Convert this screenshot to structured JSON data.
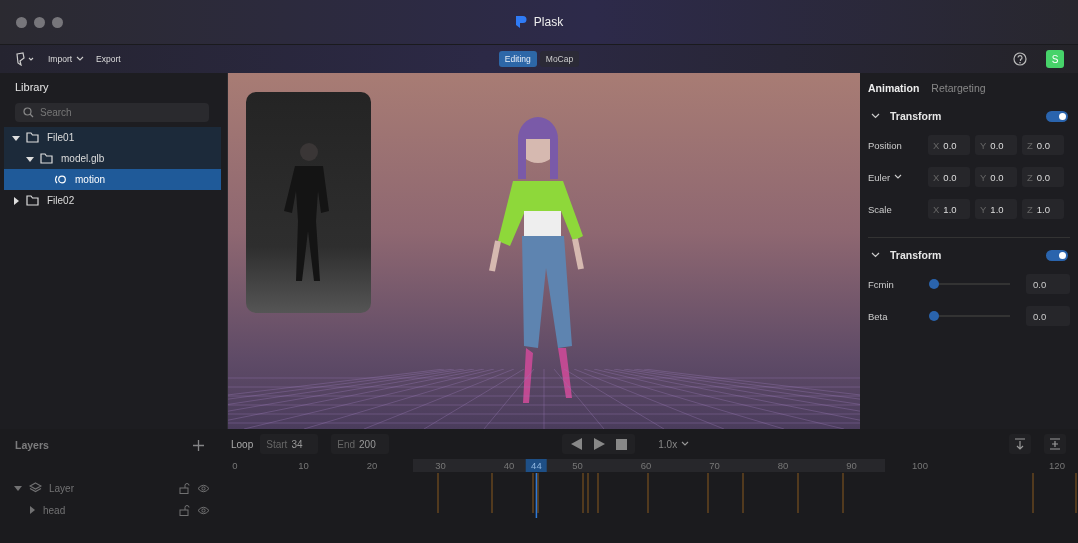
{
  "window": {
    "title": "Plask"
  },
  "toolbar": {
    "menus": [
      {
        "label": "Import",
        "dropdown": true
      },
      {
        "label": "Export",
        "dropdown": false
      }
    ],
    "modes": [
      {
        "label": "Editing",
        "selected": true
      },
      {
        "label": "MoCap",
        "selected": false
      }
    ],
    "avatar": "S"
  },
  "library": {
    "title": "Library",
    "search": {
      "placeholder": "Search"
    },
    "tree": [
      {
        "label": "File01",
        "kind": "folder",
        "expanded": true,
        "selected": false,
        "children": [
          {
            "label": "model.glb",
            "kind": "folder",
            "expanded": true,
            "selected": false,
            "children": [
              {
                "label": "motion",
                "kind": "motion",
                "selected": true
              }
            ]
          }
        ]
      },
      {
        "label": "File02",
        "kind": "folder",
        "expanded": false,
        "selected": false
      }
    ]
  },
  "inspector": {
    "tabs": [
      {
        "label": "Animation",
        "selected": true
      },
      {
        "label": "Retargeting",
        "selected": false
      }
    ],
    "sections": [
      {
        "title": "Transform",
        "on": true,
        "rows": [
          {
            "kind": "vector",
            "label": "Position",
            "dropdown": false,
            "values": [
              {
                "axis": "X",
                "value": "0.0"
              },
              {
                "axis": "Y",
                "value": "0.0"
              },
              {
                "axis": "Z",
                "value": "0.0"
              }
            ]
          },
          {
            "kind": "vector",
            "label": "Euler",
            "dropdown": true,
            "values": [
              {
                "axis": "X",
                "value": "0.0"
              },
              {
                "axis": "Y",
                "value": "0.0"
              },
              {
                "axis": "Z",
                "value": "0.0"
              }
            ]
          },
          {
            "kind": "vector",
            "label": "Scale",
            "dropdown": false,
            "values": [
              {
                "axis": "X",
                "value": "1.0"
              },
              {
                "axis": "Y",
                "value": "1.0"
              },
              {
                "axis": "Z",
                "value": "1.0"
              }
            ]
          }
        ]
      },
      {
        "title": "Transform",
        "on": true,
        "rows": [
          {
            "kind": "slider",
            "label": "Fcmin",
            "level": 0,
            "value": "0.0"
          },
          {
            "kind": "slider",
            "label": "Beta",
            "level": 0,
            "value": "0.0"
          }
        ]
      }
    ]
  },
  "layers": {
    "title": "Layers",
    "disabled": true,
    "items": [
      {
        "label": "Layer",
        "expanded": true,
        "children": [
          {
            "label": "head",
            "expanded": false
          }
        ]
      }
    ]
  },
  "timeline": {
    "loop_label": "Loop",
    "start": {
      "label": "Start",
      "value": "34"
    },
    "end": {
      "label": "End",
      "value": "200"
    },
    "speed": "1.0x",
    "ticks": [
      "0",
      "10",
      "20",
      "30",
      "40",
      "50",
      "60",
      "70",
      "80",
      "90",
      "100",
      "120"
    ],
    "current": "44"
  }
}
